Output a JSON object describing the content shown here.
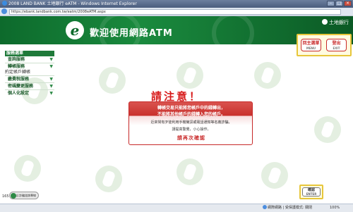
{
  "window": {
    "title": "2008 LAND BANK 土地銀行 eATM - Windows Internet Explorer",
    "url": "https://ebank.landbank.com.tw/eatm/2008eATM.aspx"
  },
  "header": {
    "title": "歡迎使用網路ATM",
    "bank_name": "土地銀行"
  },
  "sidebar": {
    "heading": "服務選單",
    "items": [
      {
        "label": "查詢服務"
      },
      {
        "label": "轉帳服務"
      },
      {
        "label": "約定帳戶轉帳"
      },
      {
        "label": "繳費稅服務"
      },
      {
        "label": "密碼變更服務"
      },
      {
        "label": "個人化設定"
      }
    ]
  },
  "top_buttons": {
    "menu_label": "回主選單",
    "menu_sub": "MENU",
    "exit_label": "登出",
    "exit_sub": "EXIT"
  },
  "notice": {
    "title": "請注意！",
    "line1": "轉帳交易只能將您帳戶中的錢轉出，",
    "line2": "不能將其他帳戶的錢轉入您的帳戶。",
    "line3": "近來常有歹徒利用手機簡訊或電話通知等名義詐騙，",
    "line4": "請提高警覺，小心操作。",
    "line5": "請再次確認"
  },
  "confirm_button": {
    "label": "確認",
    "sub": "ENTER"
  },
  "footer": {
    "number": "165",
    "logo_text": "反詐騙諮詢專線"
  },
  "statusbar": {
    "zone": "網際網路 | 受保護模式: 關閉",
    "zoom": "100%"
  },
  "colors": {
    "header_green": "#0d6a2c",
    "alert_red": "#d81c1c",
    "button_highlight": "#e7c63a"
  }
}
